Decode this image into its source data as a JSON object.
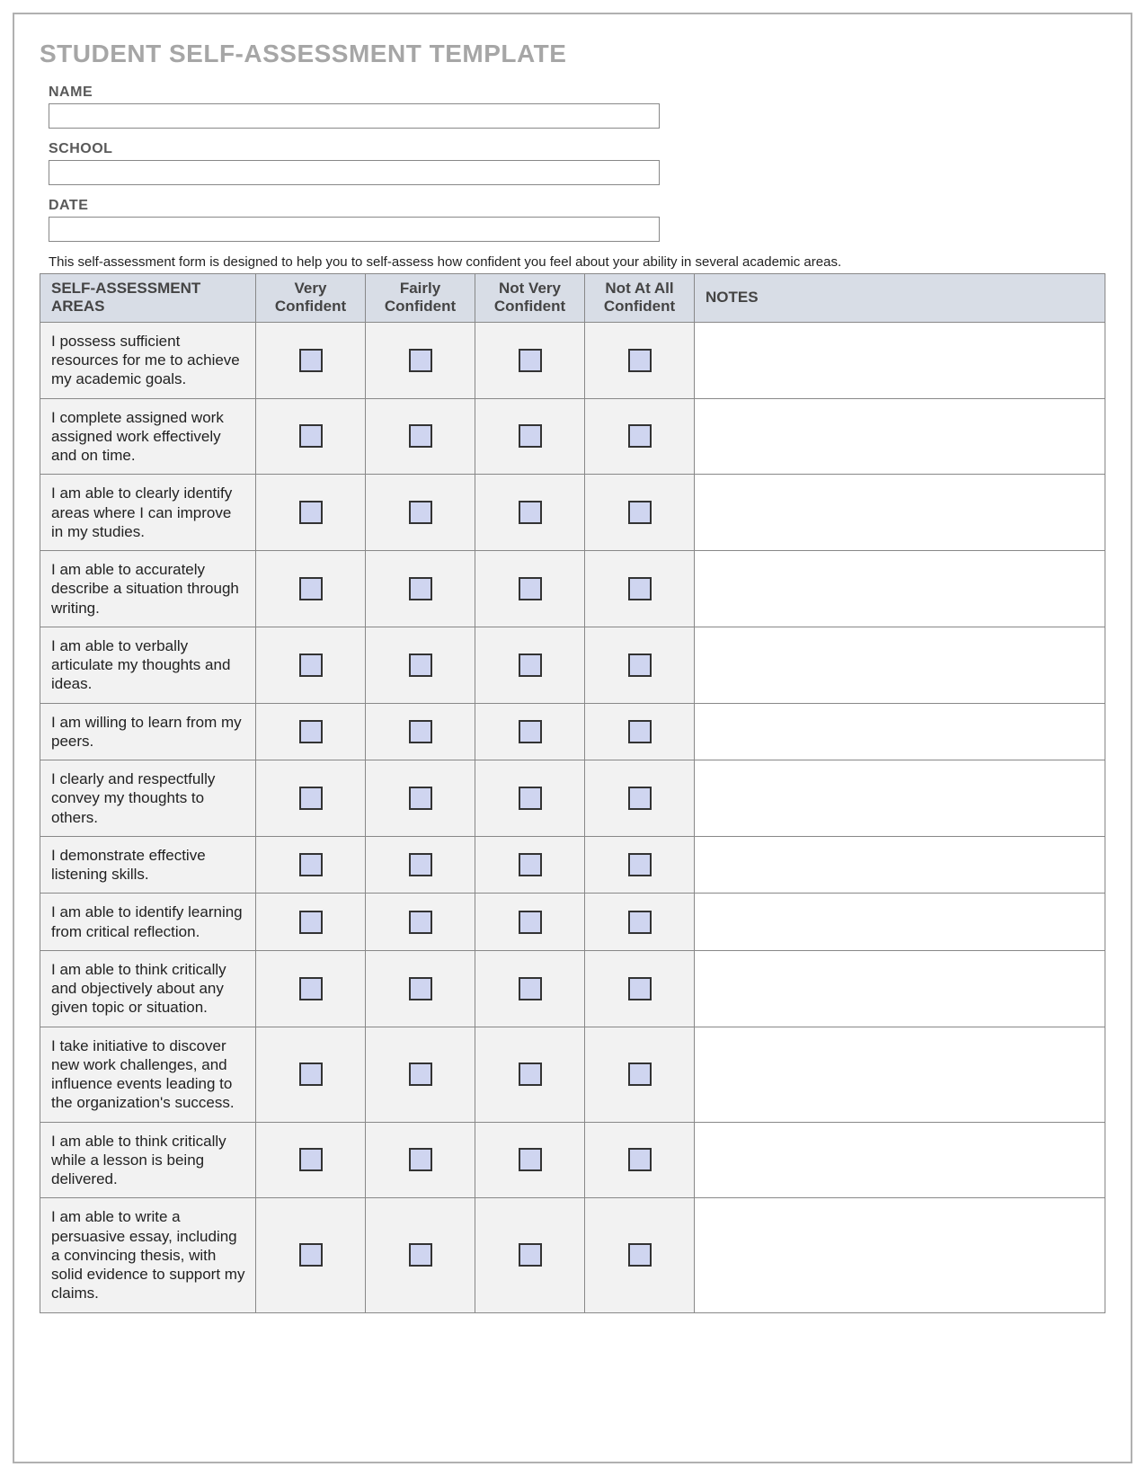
{
  "title": "STUDENT SELF-ASSESSMENT TEMPLATE",
  "fields": {
    "name": {
      "label": "NAME",
      "value": ""
    },
    "school": {
      "label": "SCHOOL",
      "value": ""
    },
    "date": {
      "label": "DATE",
      "value": ""
    }
  },
  "intro": "This self-assessment form is designed to help you to self-assess how confident you feel about your ability in several academic areas.",
  "table": {
    "headers": {
      "areas": "SELF-ASSESSMENT AREAS",
      "col1": "Very Confident",
      "col2": "Fairly Confident",
      "col3": "Not Very Confident",
      "col4": "Not At All Confident",
      "notes": "NOTES"
    },
    "rows": [
      {
        "text": "I possess sufficient resources for me to achieve my academic goals."
      },
      {
        "text": "I complete assigned work assigned work effectively and on time."
      },
      {
        "text": "I am able to clearly identify areas where I can improve in my studies."
      },
      {
        "text": "I am able to accurately describe a situation through writing."
      },
      {
        "text": "I am able to verbally articulate my thoughts and ideas."
      },
      {
        "text": "I am willing to learn from my peers."
      },
      {
        "text": "I clearly and respectfully convey my thoughts to others."
      },
      {
        "text": "I demonstrate effective listening skills."
      },
      {
        "text": "I am able to identify learning from critical reflection."
      },
      {
        "text": "I am able to think critically and objectively about any given topic or situation."
      },
      {
        "text": "I take initiative to discover new work challenges, and influence events leading to the organization's success."
      },
      {
        "text": "I am able to think critically while a lesson is being delivered."
      },
      {
        "text": "I am able to write a persuasive essay, including a convincing thesis, with solid evidence to support my claims."
      }
    ]
  }
}
